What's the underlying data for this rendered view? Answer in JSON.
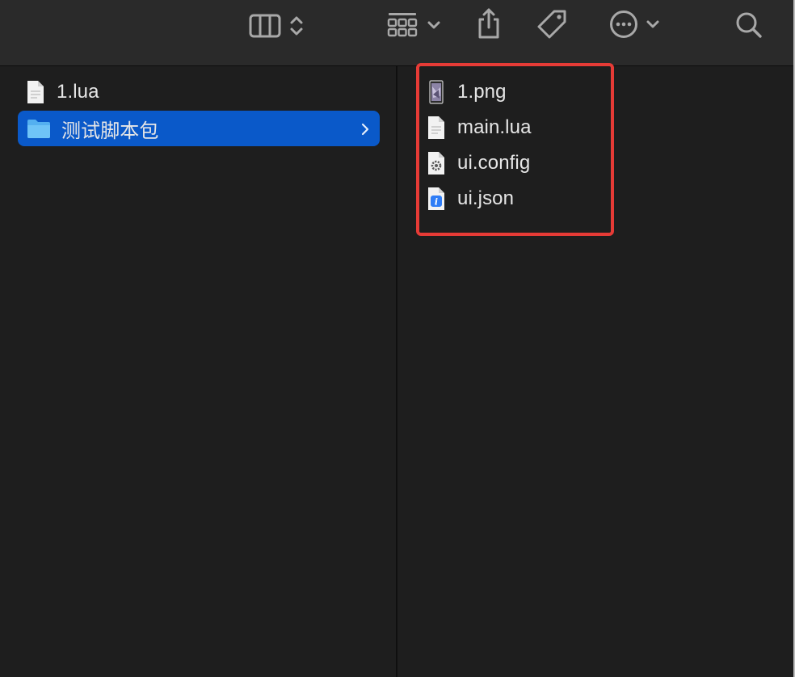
{
  "toolbar": {
    "icons": [
      "columns-view-icon",
      "updown-chevron-icon",
      "grid-group-icon",
      "chevron-down-icon",
      "share-icon",
      "tag-icon",
      "more-ellipsis-icon",
      "chevron-down-icon",
      "search-icon"
    ]
  },
  "left_column": {
    "items": [
      {
        "label": "1.lua",
        "icon": "lua-document-icon"
      },
      {
        "label": "测试脚本包",
        "icon": "folder-icon",
        "selected": true
      }
    ]
  },
  "right_column": {
    "items": [
      {
        "label": "1.png",
        "icon": "png-image-icon"
      },
      {
        "label": "main.lua",
        "icon": "lua-document-icon"
      },
      {
        "label": "ui.config",
        "icon": "config-gear-document-icon"
      },
      {
        "label": "ui.json",
        "icon": "json-info-document-icon"
      }
    ]
  },
  "colors": {
    "selection": "#0a59c9",
    "highlight_outline": "#e63b36",
    "background": "#1e1e1e",
    "toolbar": "#2a2a2a"
  }
}
